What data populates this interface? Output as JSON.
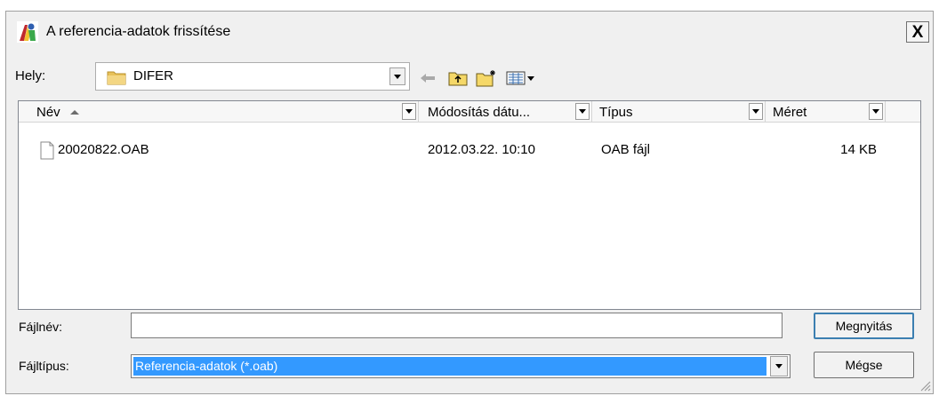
{
  "window": {
    "title": "A referencia-adatok frissítése",
    "close_label": "X"
  },
  "location": {
    "label": "Hely:",
    "value": "DIFER",
    "folder_icon": "folder-icon"
  },
  "toolbar": {
    "back_icon": "back-arrow-icon",
    "up_icon": "up-folder-icon",
    "new_folder_icon": "new-folder-icon",
    "view_menu_icon": "view-menu-icon"
  },
  "list": {
    "columns": [
      {
        "label": "Név",
        "sort": "ascending"
      },
      {
        "label": "Módosítás dátu..."
      },
      {
        "label": "Típus"
      },
      {
        "label": "Méret"
      }
    ],
    "files": [
      {
        "name": "20020822.OAB",
        "modified": "2012.03.22. 10:10",
        "type": "OAB fájl",
        "size": "14 KB",
        "icon": "file-icon"
      }
    ]
  },
  "filename": {
    "label": "Fájlnév:",
    "value": ""
  },
  "filetype": {
    "label": "Fájltípus:",
    "value": "Referencia-adatok (*.oab)"
  },
  "buttons": {
    "open": "Megnyitás",
    "cancel": "Mégse"
  },
  "colors": {
    "selection": "#3399ff",
    "dialog_bg": "#f0f0f0"
  }
}
